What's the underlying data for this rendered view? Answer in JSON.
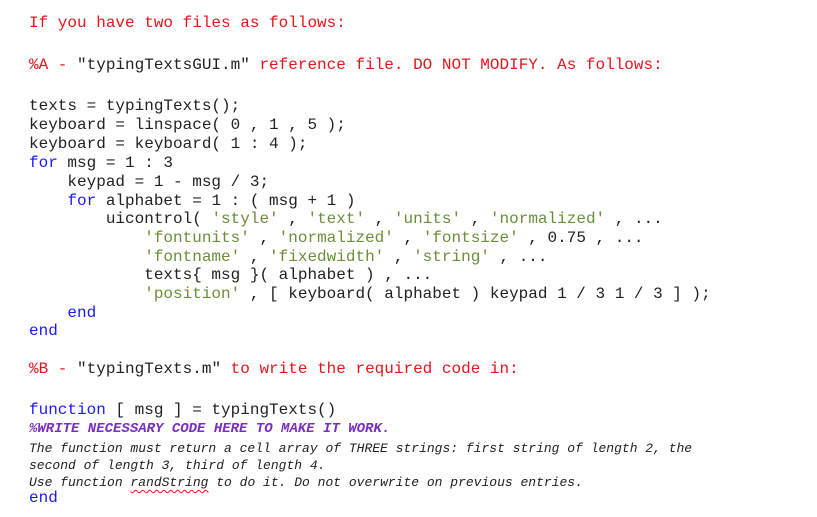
{
  "intro": "If you have two files as follows:",
  "fileA": {
    "prefix": "%A - ",
    "filename": "\"typingTextsGUI.m\"",
    "suffix": " reference file. DO NOT MODIFY. As follows:"
  },
  "codeA": {
    "l1": "texts = typingTexts();",
    "l2": "keyboard = linspace( 0 , 1 , 5 );",
    "l3": "keyboard = keyboard( 1 : 4 );",
    "l4_kw": "for",
    "l4_rest": " msg = 1 : 3",
    "l5": "    keypad = 1 - msg / 3;",
    "l6_indent": "    ",
    "l6_kw": "for",
    "l6_rest": " alphabet = 1 : ( msg + 1 )",
    "l7_a": "        uicontrol( ",
    "l7_s1": "'style'",
    "l7_b": " , ",
    "l7_s2": "'text'",
    "l7_c": " , ",
    "l7_s3": "'units'",
    "l7_d": " , ",
    "l7_s4": "'normalized'",
    "l7_e": " , ...",
    "l8_a": "            ",
    "l8_s1": "'fontunits'",
    "l8_b": " , ",
    "l8_s2": "'normalized'",
    "l8_c": " , ",
    "l8_s3": "'fontsize'",
    "l8_d": " , 0.75 , ...",
    "l9_a": "            ",
    "l9_s1": "'fontname'",
    "l9_b": " , ",
    "l9_s2": "'fixedwidth'",
    "l9_c": " , ",
    "l9_s3": "'string'",
    "l9_d": " , ...",
    "l10": "            texts{ msg }( alphabet ) , ...",
    "l11_a": "            ",
    "l11_s1": "'position'",
    "l11_b": " , [ keyboard( alphabet ) keypad 1 / 3 1 / 3 ] );",
    "l12_indent": "    ",
    "l12_kw": "end",
    "l13_kw": "end"
  },
  "fileB": {
    "prefix": "%B - ",
    "filename": "\"typingTexts.m\"",
    "suffix": " to write the required code in:"
  },
  "codeB": {
    "l1_kw": "function",
    "l1_rest": " [ msg ] = typingTexts()",
    "l2": "%WRITE NECESSARY CODE HERE TO MAKE IT WORK.",
    "l3": "The function must return a cell array of THREE strings: first string of length 2, the",
    "l4": "second of length 3, third of length 4.",
    "l5_a": "Use function ",
    "l5_link": "randString",
    "l5_b": " to do it. Do not overwrite on previous entries.",
    "l6_kw": "end"
  }
}
